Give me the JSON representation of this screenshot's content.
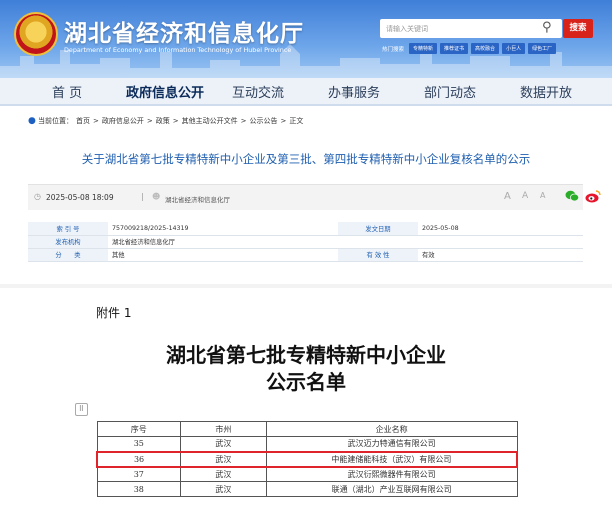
{
  "header": {
    "site_title": "湖北省经济和信息化厅",
    "site_subtitle": "Department of Economy and Information Technology of Hubei Province",
    "search_placeholder": "请输入关键词",
    "search_button": "搜索",
    "hot_label": "热门搜索",
    "hot_tags": [
      "专精特新",
      "推荐证书",
      "高校融合",
      "小巨人",
      "绿色工厂"
    ]
  },
  "nav": {
    "items": [
      {
        "label": "首 页",
        "active": false
      },
      {
        "label": "政府信息公开",
        "active": true
      },
      {
        "label": "互动交流",
        "active": false
      },
      {
        "label": "办事服务",
        "active": false
      },
      {
        "label": "部门动态",
        "active": false
      },
      {
        "label": "数据开放",
        "active": false
      }
    ]
  },
  "breadcrumb": {
    "prefix": "当前位置：",
    "items": [
      "首页",
      "政府信息公开",
      "政策",
      "其他主动公开文件",
      "公示公告",
      "正文"
    ],
    "separator": ">"
  },
  "article": {
    "title": "关于湖北省第七批专精特新中小企业及第三批、第四批专精特新中小企业复核名单的公示",
    "date": "2025-05-08 18:09",
    "publisher": "湖北省经济和信息化厅",
    "font_sizes": [
      "A",
      "A",
      "A"
    ]
  },
  "info": {
    "index_label": "索 引 号",
    "index_value": "757009218/2025-14319",
    "date_label": "发文日期",
    "date_value": "2025-05-08",
    "org_label": "发布机构",
    "org_value": "湖北省经济和信息化厅",
    "cat_label": "分　　类",
    "cat_value": "其他",
    "valid_label": "有 效 性",
    "valid_value": "有效"
  },
  "document": {
    "attachment": "附件 1",
    "title_line1": "湖北省第七批专精特新中小企业",
    "title_line2": "公示名单",
    "grip_icon": "⠿",
    "table": {
      "headers": [
        "序号",
        "市州",
        "企业名称"
      ],
      "rows": [
        {
          "no": "35",
          "city": "武汉",
          "name": "武汉迈力特通信有限公司",
          "highlight": false
        },
        {
          "no": "36",
          "city": "武汉",
          "name": "中能建储能科技（武汉）有限公司",
          "highlight": true
        },
        {
          "no": "37",
          "city": "武汉",
          "name": "武汉衍熙微器件有限公司",
          "highlight": false
        },
        {
          "no": "38",
          "city": "武汉",
          "name": "联通（湖北）产业互联网有限公司",
          "highlight": false
        }
      ]
    }
  },
  "colors": {
    "header_blue": "#3f7fd8",
    "title_blue": "#1f5fb0",
    "search_red": "#d8231a",
    "highlight_red": "#e0242b"
  }
}
